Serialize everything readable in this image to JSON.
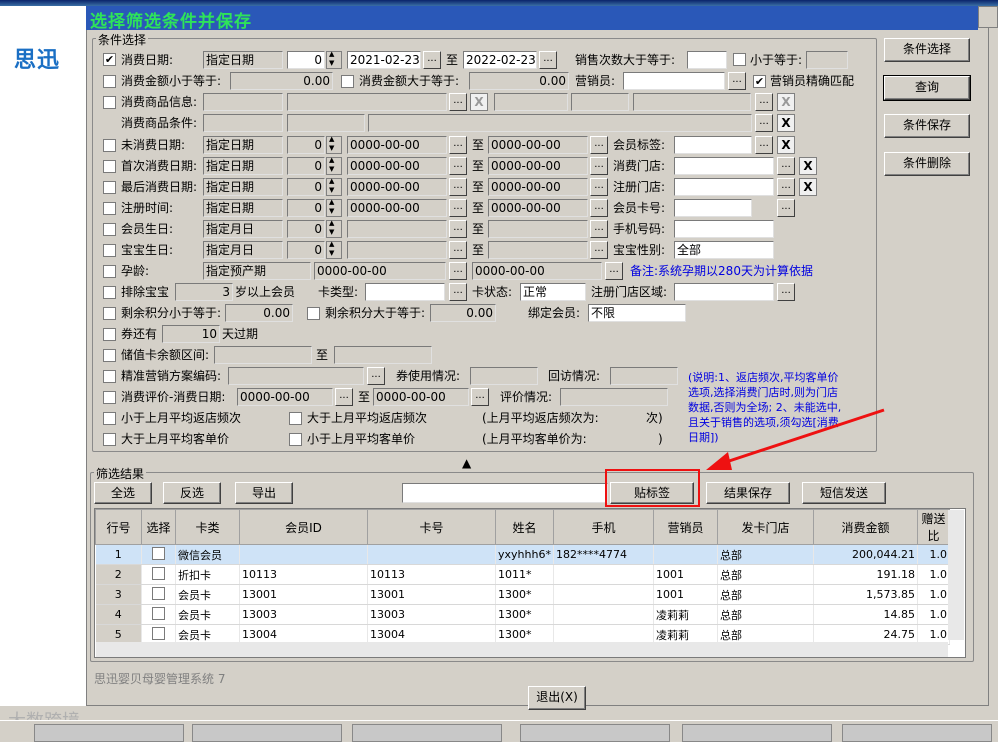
{
  "logo": "思迅",
  "dialog_title": "选择筛选条件并保存",
  "group_conditions": "条件选择",
  "group_results": "筛选结果",
  "side_buttons": {
    "select": "条件选择",
    "query": "查询",
    "save": "条件保存",
    "delete": "条件删除"
  },
  "rows": {
    "consume_date": "消费日期:",
    "date_mode": "指定日期",
    "num0": "0",
    "date_from": "2021-02-23",
    "to": "至",
    "date_to": "2022-02-23",
    "count_ge": "销售次数大于等于:",
    "lt_eq": "小于等于:",
    "amount_le": "消费金额小于等于:",
    "amount_ge": "消费金额大于等于:",
    "amt0": "0.00",
    "salesman": "营销员:",
    "salesman_exact": "营销员精确匹配",
    "goods_info": "消费商品信息:",
    "goods_cond": "消费商品条件:",
    "no_consume": "未消费日期:",
    "zero_date": "0000-00-00",
    "member_tag": "会员标签:",
    "first_consume": "首次消费日期:",
    "consume_store": "消费门店:",
    "last_consume": "最后消费日期:",
    "reg_store": "注册门店:",
    "reg_time": "注册时间:",
    "member_card": "会员卡号:",
    "member_birthday": "会员生日:",
    "month_mode": "指定月日",
    "phone": "手机号码:",
    "baby_birthday": "宝宝生日:",
    "baby_gender": "宝宝性别:",
    "gender_all": "全部",
    "pregnancy": "孕龄:",
    "due_mode": "指定预产期",
    "pregnancy_note": "备注:系统孕期以280天为计算依据",
    "exclude_baby": "排除宝宝",
    "age3": "3",
    "age_above": "岁以上会员",
    "card_type": "卡类型:",
    "card_state": "卡状态:",
    "state_normal": "正常",
    "reg_area": "注册门店区域:",
    "points_le": "剩余积分小于等于:",
    "points_ge": "剩余积分大于等于:",
    "bind_member": "绑定会员:",
    "unlimited": "不限",
    "coupon": "券还有",
    "days10": "10",
    "days_expire": "天过期",
    "stored_value": "储值卡余额区间:",
    "precise_code": "精准营销方案编码:",
    "coupon_usage": "券使用情况:",
    "visit": "回访情况:",
    "evaluation": "消费评价-消费日期:",
    "eval_status": "评价情况:",
    "lt_freq": "小于上月平均返店频次",
    "gt_freq": "大于上月平均返店频次",
    "last_freq": "(上月平均返店频次为:",
    "times": "次)",
    "gt_price": "大于上月平均客单价",
    "lt_price": "小于上月平均客单价",
    "last_price": "(上月平均客单价为:",
    "close_paren": ")",
    "explain": "(说明:1、返店频次,平均客单价选项,选择消费门店时,则为门店数据,否则为全场; 2、未能选中,且关于销售的选项,须勾选[消费日期])"
  },
  "result_buttons": {
    "all": "全选",
    "invert": "反选",
    "export": "导出",
    "tag": "贴标签",
    "save": "结果保存",
    "sms": "短信发送"
  },
  "table": {
    "headers": [
      "行号",
      "选择",
      "卡类",
      "会员ID",
      "卡号",
      "姓名",
      "手机",
      "营销员",
      "发卡门店",
      "消费金额",
      "赠送比"
    ],
    "rows": [
      [
        "1",
        "",
        "微信会员",
        "",
        "",
        "yxyhhh6*",
        "182****4774",
        "",
        "总部",
        "200,044.21",
        "1.0"
      ],
      [
        "2",
        "",
        "折扣卡",
        "10113",
        "10113",
        "1011*",
        "",
        "1001",
        "总部",
        "191.18",
        "1.0"
      ],
      [
        "3",
        "",
        "会员卡",
        "13001",
        "13001",
        "1300*",
        "",
        "1001",
        "总部",
        "1,573.85",
        "1.0"
      ],
      [
        "4",
        "",
        "会员卡",
        "13003",
        "13003",
        "1300*",
        "",
        "凌莉莉",
        "总部",
        "14.85",
        "1.0"
      ],
      [
        "5",
        "",
        "会员卡",
        "13004",
        "13004",
        "1300*",
        "",
        "凌莉莉",
        "总部",
        "24.75",
        "1.0"
      ]
    ]
  },
  "footer": {
    "status": "思迅婴贝母婴管理系统 7",
    "exit": "退出(X)",
    "watermark": "大数跨境"
  },
  "colors": {
    "title_bar": "#2a58b8",
    "title_text": "#2ee35a",
    "annotation": "#e11111",
    "explain_text": "#0000e0"
  }
}
